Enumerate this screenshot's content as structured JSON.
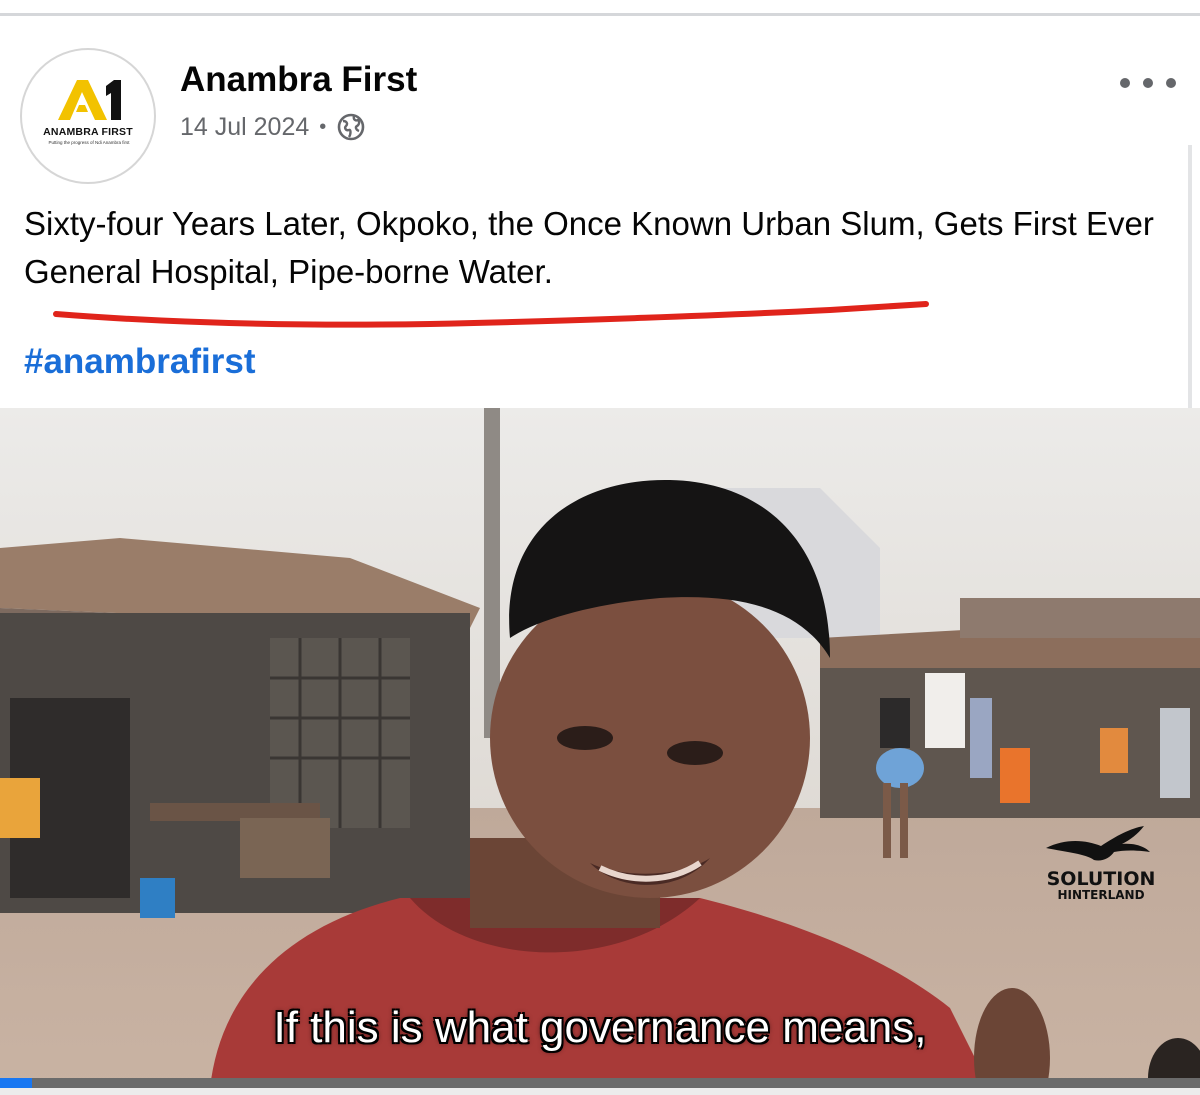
{
  "post": {
    "page_name": "Anambra First",
    "date": "14 Jul 2024",
    "separator": "•",
    "audience_icon": "globe-icon",
    "text": "Sixty-four Years Later, Okpoko, the Once Known Urban Slum, Gets First Ever General Hospital, Pipe-borne Water.",
    "hashtag": "#anambrafirst",
    "underline_color": "#e0241b",
    "hashtag_color": "#1a6ed8"
  },
  "avatar": {
    "logo_mark": "A1",
    "logo_name": "ANAMBRA FIRST",
    "logo_tagline": "Putting the progress of Ndi Anambra first",
    "logo_color": "#f2c200"
  },
  "menu": {
    "icon": "more-options-icon"
  },
  "video": {
    "watermark_line1": "SOLUTION",
    "watermark_line2": "HINTERLAND",
    "watermark_icon": "eagle-icon",
    "subtitle": "If this is what governance means,",
    "progress": 0.027,
    "progress_color": "#1877f2"
  }
}
